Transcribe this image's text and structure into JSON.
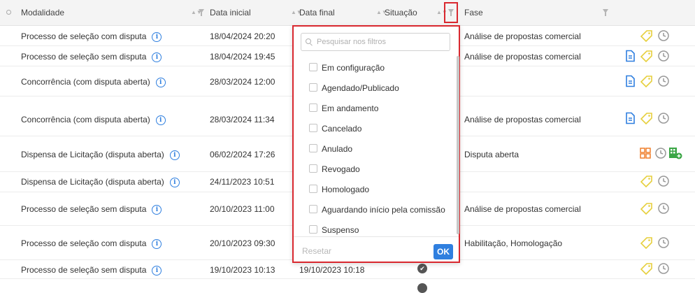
{
  "header": {
    "modalidade": "Modalidade",
    "data_inicial": "Data inicial",
    "data_final": "Data final",
    "situacao": "Situação",
    "fase": "Fase"
  },
  "rows": [
    {
      "modalidade": "Processo de seleção com disputa",
      "data_inicial": "18/04/2024 20:20",
      "data_final": "",
      "fase": "Análise de propostas comercial",
      "actions": [
        "tag-icon",
        "clock-icon"
      ]
    },
    {
      "modalidade": "Processo de seleção sem disputa",
      "data_inicial": "18/04/2024 19:45",
      "data_final": "",
      "fase": "Análise de propostas comercial",
      "actions": [
        "document-icon",
        "tag-icon",
        "clock-icon"
      ]
    },
    {
      "modalidade": "Concorrência (com disputa aberta)",
      "data_inicial": "28/03/2024 12:00",
      "data_final": "",
      "fase": "",
      "actions": [
        "document-icon",
        "tag-icon",
        "clock-icon"
      ]
    },
    {
      "modalidade": "Concorrência (com disputa aberta)",
      "data_inicial": "28/03/2024 11:34",
      "data_final": "",
      "fase": "Análise de propostas comercial",
      "actions": [
        "document-icon",
        "tag-icon",
        "clock-icon"
      ]
    },
    {
      "modalidade": "Dispensa de Licitação (disputa aberta)",
      "data_inicial": "06/02/2024 17:26",
      "data_final": "",
      "fase": "Disputa aberta",
      "actions": [
        "grid-icon",
        "clock-icon",
        "building-add-icon"
      ]
    },
    {
      "modalidade": "Dispensa de Licitação (disputa aberta)",
      "data_inicial": "24/11/2023 10:51",
      "data_final": "",
      "fase": "",
      "actions": [
        "tag-icon",
        "clock-icon"
      ]
    },
    {
      "modalidade": "Processo de seleção sem disputa",
      "data_inicial": "20/10/2023 11:00",
      "data_final": "",
      "fase": "Análise de propostas comercial",
      "actions": [
        "tag-icon",
        "clock-icon"
      ]
    },
    {
      "modalidade": "Processo de seleção com disputa",
      "data_inicial": "20/10/2023 09:30",
      "data_final": "",
      "fase": "Habilitação, Homologação",
      "actions": [
        "tag-icon",
        "clock-icon"
      ]
    },
    {
      "modalidade": "Processo de seleção sem disputa",
      "data_inicial": "19/10/2023 10:13",
      "data_final": "19/10/2023 10:18",
      "fase": "",
      "actions": [
        "tag-icon",
        "clock-icon"
      ]
    }
  ],
  "filter_dropdown": {
    "search_placeholder": "Pesquisar nos filtros",
    "options": [
      "Em configuração",
      "Agendado/Publicado",
      "Em andamento",
      "Cancelado",
      "Anulado",
      "Revogado",
      "Homologado",
      "Aguardando início pela comissão",
      "Suspenso"
    ],
    "reset_label": "Resetar",
    "ok_label": "OK"
  },
  "colors": {
    "accent": "#2f7fdf",
    "highlight": "#d9282f",
    "tag": "#e6cf3c",
    "green": "#3aa645",
    "orange": "#ef7e2a"
  }
}
